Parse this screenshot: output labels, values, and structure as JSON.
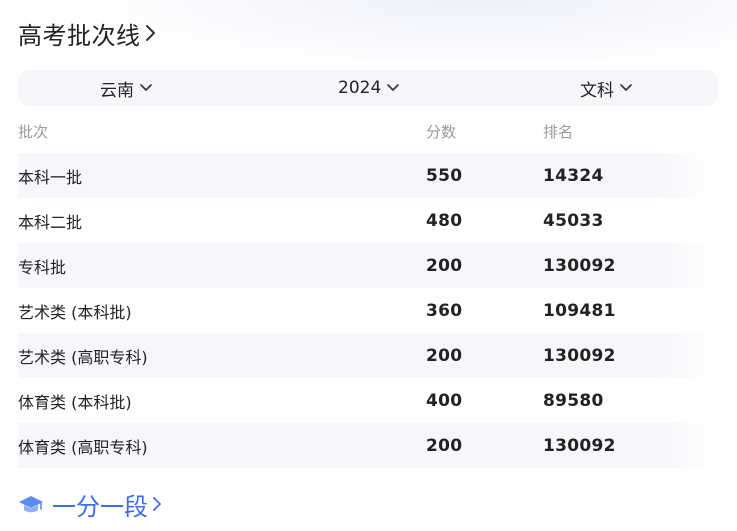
{
  "header": {
    "title": "高考批次线"
  },
  "filters": {
    "province": "云南",
    "year": "2024",
    "subject": "文科"
  },
  "table": {
    "columns": [
      "批次",
      "分数",
      "排名"
    ],
    "rows": [
      {
        "batch": "本科一批",
        "score": "550",
        "rank": "14324"
      },
      {
        "batch": "本科二批",
        "score": "480",
        "rank": "45033"
      },
      {
        "batch": "专科批",
        "score": "200",
        "rank": "130092"
      },
      {
        "batch": "艺术类 (本科批)",
        "score": "360",
        "rank": "109481"
      },
      {
        "batch": "艺术类 (高职专科)",
        "score": "200",
        "rank": "130092"
      },
      {
        "batch": "体育类 (本科批)",
        "score": "400",
        "rank": "89580"
      },
      {
        "batch": "体育类 (高职专科)",
        "score": "200",
        "rank": "130092"
      }
    ]
  },
  "footer": {
    "link_label": "一分一段",
    "icon": "graduation-cap-icon"
  },
  "colors": {
    "accent": "#3b6ee8",
    "text": "#222222",
    "muted": "#999999",
    "row_shade": "#f6f7fa"
  }
}
